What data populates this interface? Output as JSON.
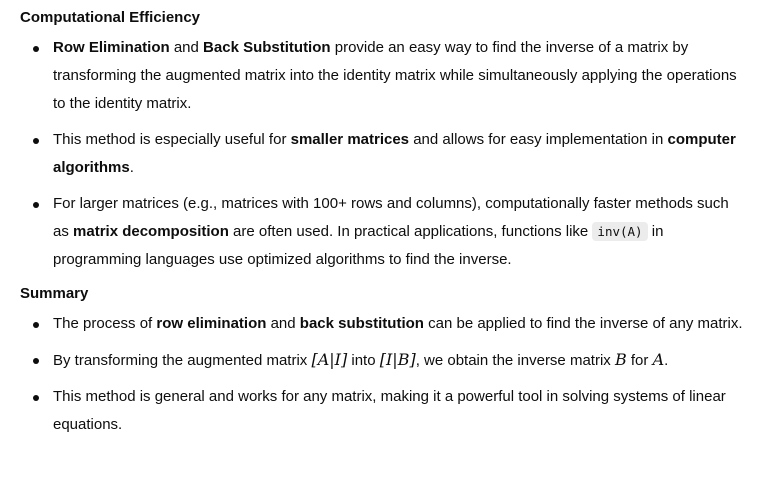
{
  "sections": [
    {
      "heading": "Computational Efficiency",
      "items": [
        {
          "s": [
            "Row Elimination",
            " and ",
            "Back Substitution",
            " provide an easy way to find the inverse of a matrix by transforming the augmented matrix into the identity matrix while simultaneously applying the operations to the identity matrix."
          ]
        },
        {
          "s": [
            "This method is especially useful for ",
            "smaller matrices",
            " and allows for easy implementation in ",
            "computer algorithms",
            "."
          ]
        },
        {
          "s": [
            "For larger matrices (e.g., matrices with 100+ rows and columns), computationally faster methods such as ",
            "matrix decomposition",
            " are often used. In practical applications, functions like ",
            "inv(A)",
            " in programming languages use optimized algorithms to find the inverse."
          ]
        }
      ]
    },
    {
      "heading": "Summary",
      "items": [
        {
          "s": [
            "The process of ",
            "row elimination",
            " and ",
            "back substitution",
            " can be applied to find the inverse of any matrix."
          ]
        },
        {
          "s": [
            "By transforming the augmented matrix ",
            "[A|I]",
            " into ",
            "[I|B]",
            ", we obtain the inverse matrix ",
            "B",
            " for ",
            "A",
            "."
          ]
        },
        {
          "s": [
            "This method is general and works for any matrix, making it a powerful tool in solving systems of linear equations."
          ]
        }
      ]
    }
  ]
}
